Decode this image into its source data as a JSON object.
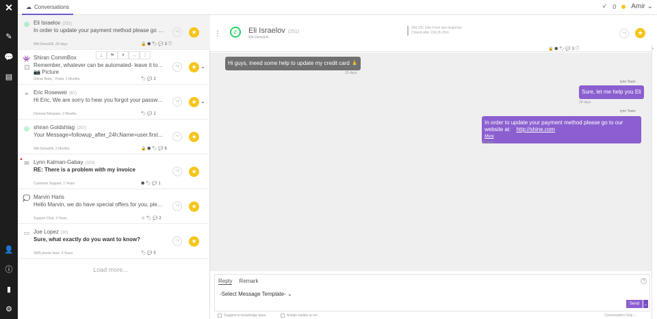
{
  "nav": {
    "logo": "✕",
    "icons": [
      "compose-icon",
      "chat-icon",
      "book-icon",
      "people-icon",
      "info-icon",
      "stats-icon",
      "settings-icon"
    ]
  },
  "topbar": {
    "tab_label": "Conversations",
    "check_count": "0",
    "user_name": "Amir",
    "status_color": "#f5c518"
  },
  "conversations": [
    {
      "name": "Eli Israelov",
      "count": "(251)",
      "message": "In order to update your payment method please go to...",
      "meta": "WA DemoEN, 29 days",
      "mini": "🔒 ⬢ 🏷 💬 3 ⓘ",
      "channel": "whatsapp"
    },
    {
      "name": "Shiran CommBox",
      "message": "Remember, whatever can be automated- leave it to o...",
      "attachment": "📷 Picture",
      "meta": "Shiran Baby - Posts, 1 Months",
      "mini": "🏷 💬 2",
      "channel": "bot"
    },
    {
      "name": "Eric Roseweir",
      "count": "(67)",
      "message": "Hi Eric, We are sorry to hear you forgot your passwor...",
      "meta": "DemoenTelegram, 2 Months",
      "mini": "🏷 💬 2",
      "channel": "telegram"
    },
    {
      "name": "shiran Goldshlag",
      "count": "(257)",
      "message": "Your Message=followup_after_24h;Name=user.first_...",
      "meta": "WA DemoEN, 2 Months",
      "mini": "🔒 ⬢ 🏷 💬 6",
      "channel": "whatsapp"
    },
    {
      "name": "Lynn Kalman-Gabay",
      "count": "(103)",
      "message": "RE: There is a problem with my invoice",
      "meta": "Customer Support, 1 Years",
      "mini": "⬢ 🏷 💬 1",
      "channel": "email"
    },
    {
      "name": "Marvin Haris",
      "message": "Hello Marvin, we do have special offers for you, pleas...",
      "meta": "Support Chat, 4 Years",
      "mini": "☺ 🏷 💬 2",
      "channel": "chat"
    },
    {
      "name": "Joe Lopez",
      "count": "(30)",
      "message": "Sure, what exactly do you want to know?",
      "meta": "SMS phone lines, 4 Years",
      "mini": "🏷 💬 5",
      "channel": "sms"
    }
  ],
  "load_more": "Load more...",
  "conversation": {
    "name": "Eli Israelov",
    "count": "(251)",
    "subtitle": "WA DemoEN",
    "stat_line1": "29d 22h 19m From last response",
    "stat_line2": "Closed after 22d 2h 35m",
    "mini": "🔒 ⬢ 🏷 💬 3 ⓘ"
  },
  "messages": [
    {
      "direction": "in",
      "text": "Hi guys, ineed some help to update my credit card 🙏",
      "time": "29 days"
    },
    {
      "direction": "out",
      "sender": "lynn Team",
      "text": "Sure, let me help you Eli",
      "time": "29 days"
    },
    {
      "direction": "out",
      "sender": "lynn Team",
      "text": "In order to update your payment method please go to our website at:",
      "link": "http://shine.com",
      "more": "More",
      "time": "29 days"
    }
  ],
  "reply": {
    "tab_reply": "Reply",
    "tab_remark": "Remark",
    "template_select": "-Select Message Template-",
    "send_label": "Send",
    "suggest_label": "Suggest to knowledge base",
    "assign_label": "Assign replies to me",
    "conversation_only": "Conversation Only"
  }
}
